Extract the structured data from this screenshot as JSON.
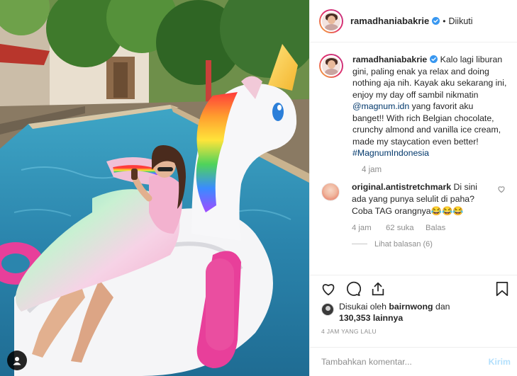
{
  "post": {
    "username": "ramadhaniabakrie",
    "follow_state": "Diikuti",
    "dot": "•",
    "caption_username": "ramadhaniabakrie",
    "caption_part1": " Kalo lagi liburan gini, paling enak ya relax and doing nothing aja nih. Kayak aku sekarang ini, enjoy my day off sambil nikmatin ",
    "caption_mention": "@magnum.idn",
    "caption_part2": " yang favorit aku banget!! With rich Belgian chocolate, crunchy almond and vanilla ice cream, made my staycation even better! ",
    "caption_hashtag": "#MagnumIndonesia",
    "caption_time": "4 jam"
  },
  "comment": {
    "username": "original.antistretchmark",
    "text": " Di sini ada yang punya selulit di paha? Coba TAG orangnya😂😂😂",
    "time": "4 jam",
    "likes": "62 suka",
    "reply": "Balas",
    "view_replies": "Lihat balasan (6)"
  },
  "likes": {
    "prefix": "Disukai oleh ",
    "first_user": "bairnwong",
    "middle": " dan ",
    "count": "130,353 lainnya"
  },
  "timestamp": "4 JAM YANG LALU",
  "comment_box": {
    "placeholder": "Tambahkan komentar...",
    "post_label": "Kirim"
  },
  "colors": {
    "verified": "#3897f0",
    "link": "#00376b",
    "muted": "#8e8e8e",
    "post_disabled": "#b2dffc"
  },
  "icons": [
    "heart-icon",
    "comment-icon",
    "share-icon",
    "bookmark-icon",
    "verified-icon",
    "user-tag-icon"
  ]
}
